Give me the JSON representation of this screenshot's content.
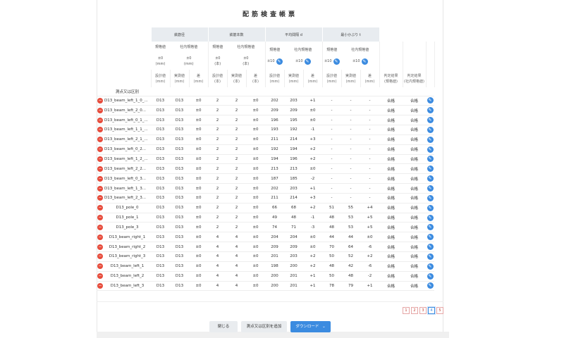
{
  "title": "配筋検査帳票",
  "groups": [
    "鉄筋径",
    "鉄筋本数",
    "平均間隔 d",
    "最小かぶり t"
  ],
  "spec_labels": [
    "規格値",
    "社内規格値"
  ],
  "spec_values": {
    "dia": {
      "std": "±0\n(mm)",
      "internal": "±0\n(mm)"
    },
    "count": {
      "std": "±0\n(本)",
      "internal": "±0\n(本)"
    },
    "spacing": {
      "std": "±10",
      "internal": "±10"
    },
    "cover": {
      "std": "±10",
      "internal": "±10"
    }
  },
  "col_labels": {
    "design": "設計値",
    "measured": "実測値",
    "diff": "差",
    "unit_mm": "(mm)",
    "unit_hon": "(本)",
    "judge": "判定結果",
    "judge_sub": "(規格値)",
    "judge_internal": "判定結果",
    "judge_internal_sub": "(社内規格値)"
  },
  "name_header": "測点又は区別",
  "rows": [
    {
      "name": "D13_beam_left_1_0_...",
      "d1": "D13",
      "d2": "D13",
      "dd": "±0",
      "c1": "2",
      "c2": "2",
      "cd": "±0",
      "s1": "202",
      "s2": "203",
      "sd": "+1",
      "v1": "-",
      "v2": "-",
      "vd": "-",
      "j1": "合格",
      "j2": "合格"
    },
    {
      "name": "D13_beam_left_2_0...",
      "d1": "D13",
      "d2": "D13",
      "dd": "±0",
      "c1": "2",
      "c2": "2",
      "cd": "±0",
      "s1": "209",
      "s2": "209",
      "sd": "±0",
      "v1": "-",
      "v2": "-",
      "vd": "-",
      "j1": "合格",
      "j2": "合格"
    },
    {
      "name": "D13_beam_left_0_1_...",
      "d1": "D13",
      "d2": "D13",
      "dd": "±0",
      "c1": "2",
      "c2": "2",
      "cd": "±0",
      "s1": "196",
      "s2": "195",
      "sd": "±0",
      "v1": "-",
      "v2": "-",
      "vd": "-",
      "j1": "合格",
      "j2": "合格"
    },
    {
      "name": "D13_beam_left_1_1_...",
      "d1": "D13",
      "d2": "D13",
      "dd": "±0",
      "c1": "2",
      "c2": "2",
      "cd": "±0",
      "s1": "193",
      "s2": "192",
      "sd": "-1",
      "v1": "-",
      "v2": "-",
      "vd": "-",
      "j1": "合格",
      "j2": "合格"
    },
    {
      "name": "D13_beam_left_2_1_...",
      "d1": "D13",
      "d2": "D13",
      "dd": "±0",
      "c1": "2",
      "c2": "2",
      "cd": "±0",
      "s1": "211",
      "s2": "214",
      "sd": "+3",
      "v1": "-",
      "v2": "-",
      "vd": "-",
      "j1": "合格",
      "j2": "合格"
    },
    {
      "name": "D13_beam_left_0_2...",
      "d1": "D13",
      "d2": "D13",
      "dd": "±0",
      "c1": "2",
      "c2": "2",
      "cd": "±0",
      "s1": "192",
      "s2": "194",
      "sd": "+2",
      "v1": "-",
      "v2": "-",
      "vd": "-",
      "j1": "合格",
      "j2": "合格"
    },
    {
      "name": "D13_beam_left_1_2_...",
      "d1": "D13",
      "d2": "D13",
      "dd": "±0",
      "c1": "2",
      "c2": "2",
      "cd": "±0",
      "s1": "194",
      "s2": "196",
      "sd": "+2",
      "v1": "-",
      "v2": "-",
      "vd": "-",
      "j1": "合格",
      "j2": "合格"
    },
    {
      "name": "D13_beam_left_2_2...",
      "d1": "D13",
      "d2": "D13",
      "dd": "±0",
      "c1": "2",
      "c2": "2",
      "cd": "±0",
      "s1": "213",
      "s2": "213",
      "sd": "±0",
      "v1": "-",
      "v2": "-",
      "vd": "-",
      "j1": "合格",
      "j2": "合格"
    },
    {
      "name": "D13_beam_left_0_3...",
      "d1": "D13",
      "d2": "D13",
      "dd": "±0",
      "c1": "2",
      "c2": "2",
      "cd": "±0",
      "s1": "187",
      "s2": "185",
      "sd": "-2",
      "v1": "-",
      "v2": "-",
      "vd": "-",
      "j1": "合格",
      "j2": "合格"
    },
    {
      "name": "D13_beam_left_1_3...",
      "d1": "D13",
      "d2": "D13",
      "dd": "±0",
      "c1": "2",
      "c2": "2",
      "cd": "±0",
      "s1": "202",
      "s2": "203",
      "sd": "+1",
      "v1": "-",
      "v2": "-",
      "vd": "-",
      "j1": "合格",
      "j2": "合格"
    },
    {
      "name": "D13_beam_left_2_3...",
      "d1": "D13",
      "d2": "D13",
      "dd": "±0",
      "c1": "2",
      "c2": "2",
      "cd": "±0",
      "s1": "211",
      "s2": "214",
      "sd": "+3",
      "v1": "-",
      "v2": "-",
      "vd": "-",
      "j1": "合格",
      "j2": "合格"
    },
    {
      "name": "D13_pole_0",
      "d1": "D13",
      "d2": "D13",
      "dd": "±0",
      "c1": "2",
      "c2": "2",
      "cd": "±0",
      "s1": "66",
      "s2": "68",
      "sd": "+2",
      "v1": "51",
      "v2": "55",
      "vd": "+4",
      "j1": "合格",
      "j2": "合格"
    },
    {
      "name": "D13_pole_1",
      "d1": "D13",
      "d2": "D13",
      "dd": "±0",
      "c1": "2",
      "c2": "2",
      "cd": "±0",
      "s1": "49",
      "s2": "48",
      "sd": "-1",
      "v1": "48",
      "v2": "53",
      "vd": "+5",
      "j1": "合格",
      "j2": "合格"
    },
    {
      "name": "D13_pole_3",
      "d1": "D13",
      "d2": "D13",
      "dd": "±0",
      "c1": "2",
      "c2": "2",
      "cd": "±0",
      "s1": "74",
      "s2": "71",
      "sd": "-3",
      "v1": "48",
      "v2": "53",
      "vd": "+5",
      "j1": "合格",
      "j2": "合格"
    },
    {
      "name": "D13_beam_right_1",
      "d1": "D13",
      "d2": "D13",
      "dd": "±0",
      "c1": "4",
      "c2": "4",
      "cd": "±0",
      "s1": "204",
      "s2": "204",
      "sd": "±0",
      "v1": "44",
      "v2": "44",
      "vd": "±0",
      "j1": "合格",
      "j2": "合格"
    },
    {
      "name": "D13_beam_right_2",
      "d1": "D13",
      "d2": "D13",
      "dd": "±0",
      "c1": "4",
      "c2": "4",
      "cd": "±0",
      "s1": "209",
      "s2": "209",
      "sd": "±0",
      "v1": "70",
      "v2": "64",
      "vd": "-6",
      "j1": "合格",
      "j2": "合格"
    },
    {
      "name": "D13_beam_right_3",
      "d1": "D13",
      "d2": "D13",
      "dd": "±0",
      "c1": "4",
      "c2": "4",
      "cd": "±0",
      "s1": "201",
      "s2": "203",
      "sd": "+2",
      "v1": "50",
      "v2": "52",
      "vd": "+2",
      "j1": "合格",
      "j2": "合格"
    },
    {
      "name": "D13_beam_left_1",
      "d1": "D13",
      "d2": "D13",
      "dd": "±0",
      "c1": "4",
      "c2": "4",
      "cd": "±0",
      "s1": "198",
      "s2": "200",
      "sd": "+2",
      "v1": "48",
      "v2": "42",
      "vd": "-6",
      "j1": "合格",
      "j2": "合格"
    },
    {
      "name": "D13_beam_left_2",
      "d1": "D13",
      "d2": "D13",
      "dd": "±0",
      "c1": "4",
      "c2": "4",
      "cd": "±0",
      "s1": "200",
      "s2": "201",
      "sd": "+1",
      "v1": "50",
      "v2": "48",
      "vd": "-2",
      "j1": "合格",
      "j2": "合格"
    },
    {
      "name": "D13_beam_left_3",
      "d1": "D13",
      "d2": "D13",
      "dd": "±0",
      "c1": "4",
      "c2": "4",
      "cd": "±0",
      "s1": "200",
      "s2": "201",
      "sd": "+1",
      "v1": "78",
      "v2": "79",
      "vd": "+1",
      "j1": "合格",
      "j2": "合格"
    }
  ],
  "pagination": {
    "pages": [
      "1",
      "2",
      "3",
      "4",
      "5"
    ],
    "current": "4"
  },
  "buttons": {
    "close": "閉じる",
    "add": "測点又は区別を追加",
    "download": "ダウンロード"
  },
  "icons": {
    "remove": "minus-circle-icon",
    "edit": "pencil-icon",
    "dropdown": "chevron-down-icon"
  },
  "colors": {
    "accent": "#3b8be0",
    "danger": "#e74c3c",
    "header_bg": "#e8ecf0"
  }
}
